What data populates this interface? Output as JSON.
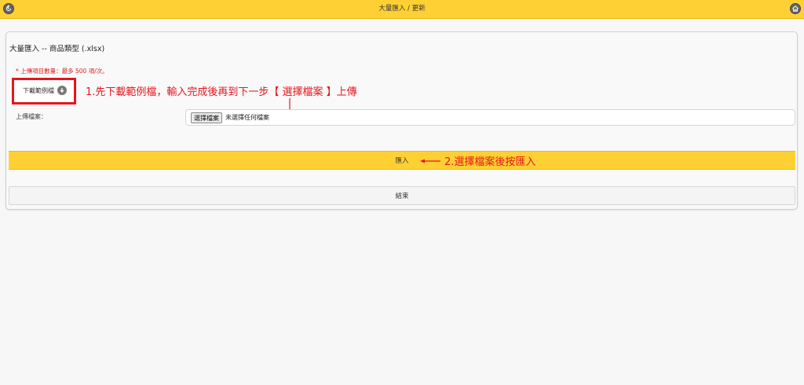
{
  "header": {
    "title": "大量匯入 / 更新",
    "back_icon": "back-arrow-icon",
    "home_icon": "home-icon",
    "bar_color": "#ffd033"
  },
  "panel": {
    "title": "大量匯入 -- 商品類型 (.xlsx)",
    "notice": "* 上傳項目數量：最多 500 項/次。",
    "download_sample_label": "下載範例檔",
    "download_icon": "download-icon",
    "upload_label": "上傳檔案：",
    "file_button_label": "選擇檔案",
    "file_status": "未選擇任何檔案",
    "import_label": "匯入",
    "end_label": "結束"
  },
  "annotations": {
    "step1": "1.先下載範例檔，輸入完成後再到下一步【 選擇檔案 】上傳",
    "step2": "2.選擇檔案後按匯入",
    "color": "#e8141c"
  }
}
